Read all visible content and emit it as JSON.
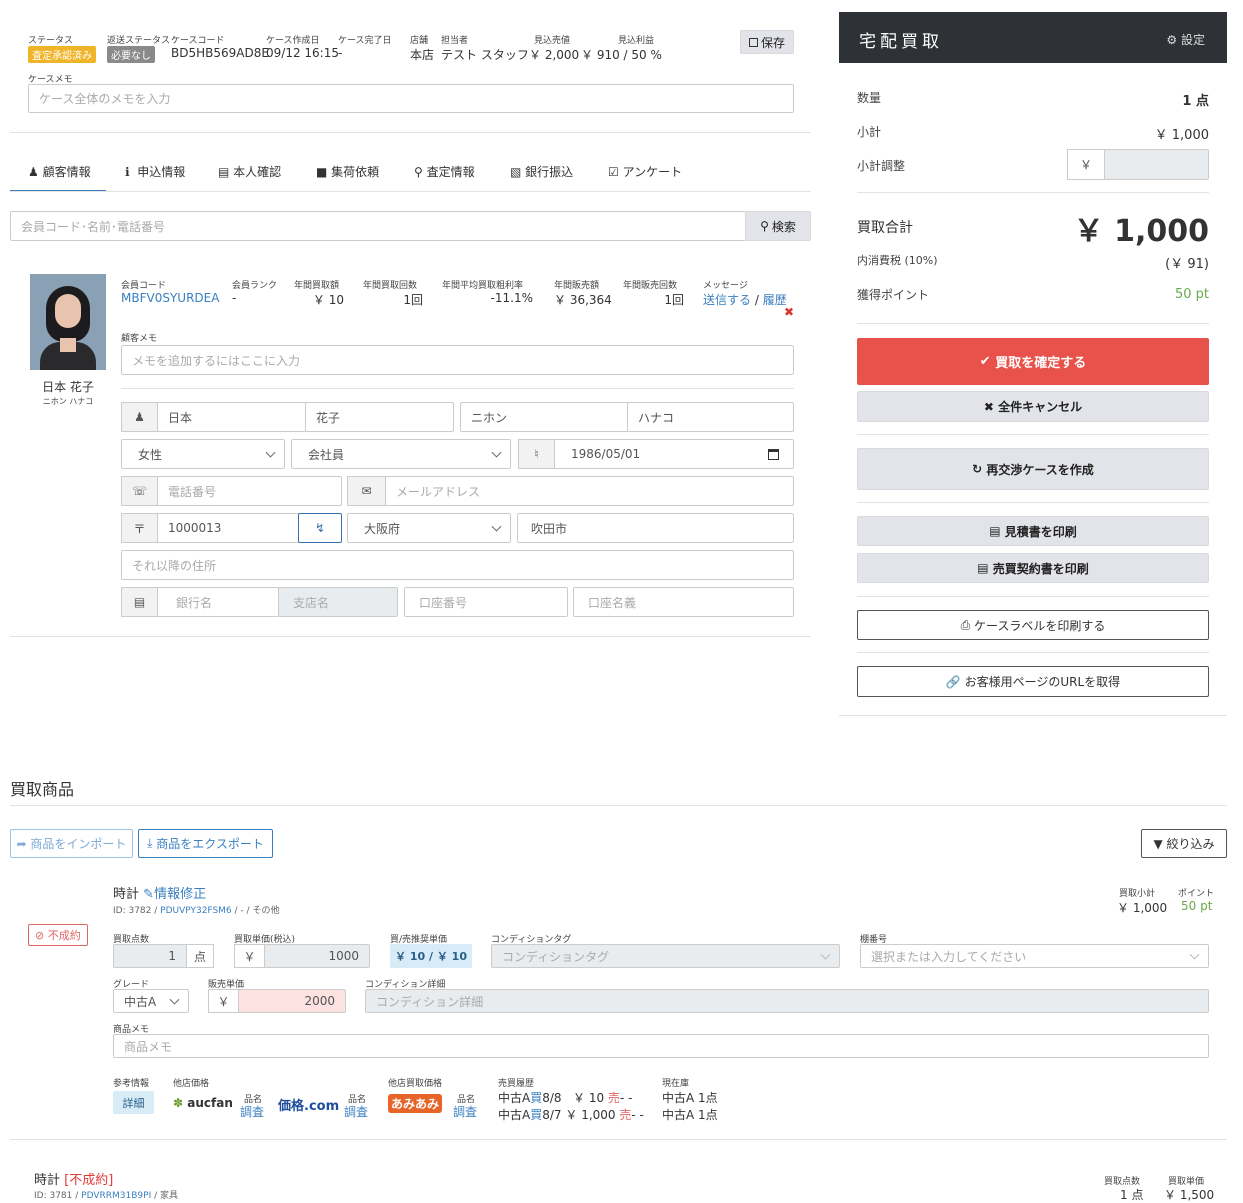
{
  "header": {
    "status_label": "ステータス",
    "status_badge": "査定承認済み",
    "return_status_label": "返送ステータス",
    "return_status_badge": "必要なし",
    "case_code_label": "ケースコード",
    "case_code": "BD5HB569AD8E",
    "created_label": "ケース作成日",
    "created": "09/12 16:15",
    "completed_label": "ケース完了日",
    "completed": "-",
    "store_label": "店舗",
    "store": "本店",
    "staff_label": "担当者",
    "staff": "テスト スタッフ",
    "est_sales_label": "見込売値",
    "est_sales": "￥ 2,000",
    "est_profit_label": "見込利益",
    "est_profit": "￥ 910 / 50 %",
    "save_label": "保存",
    "memo_label": "ケースメモ",
    "memo_placeholder": "ケース全体のメモを入力"
  },
  "tabs": [
    {
      "label": "顧客情報",
      "icon": "user-icon",
      "active": true
    },
    {
      "label": "申込情報",
      "icon": "info-icon"
    },
    {
      "label": "本人確認",
      "icon": "id-card-icon"
    },
    {
      "label": "集荷依頼",
      "icon": "truck-icon"
    },
    {
      "label": "査定情報",
      "icon": "search-icon"
    },
    {
      "label": "銀行振込",
      "icon": "money-icon"
    },
    {
      "label": "アンケート",
      "icon": "check-square-icon"
    }
  ],
  "search": {
    "placeholder": "会員コード･名前･電話番号",
    "button_label": "検索"
  },
  "customer": {
    "name": "日本 花子",
    "kana": "ニホン ハナコ",
    "member_code_label": "会員コード",
    "member_code": "MBFV0SYURDEA",
    "rank_label": "会員ランク",
    "rank": "-",
    "annual_buy_label": "年間買取額",
    "annual_buy": "￥ 10",
    "annual_buy_count_label": "年間買取回数",
    "annual_buy_count": "1回",
    "avg_margin_label": "年間平均買取粗利率",
    "avg_margin": "-11.1%",
    "annual_sales_label": "年間販売額",
    "annual_sales": "￥ 36,364",
    "annual_sales_count_label": "年間販売回数",
    "annual_sales_count": "1回",
    "message_label": "メッセージ",
    "message_send": "送信する",
    "message_sep": "/",
    "message_history": "履歴",
    "memo_label": "顧客メモ",
    "memo_placeholder": "メモを追加するにはここに入力",
    "last_name": "日本",
    "first_name": "花子",
    "last_kana": "ニホン",
    "first_kana": "ハナコ",
    "gender": "女性",
    "occupation": "会社員",
    "birthday": "1986/05/01",
    "phone_placeholder": "電話番号",
    "email_placeholder": "メールアドレス",
    "zip": "1000013",
    "prefecture": "大阪府",
    "city": "吹田市",
    "address_placeholder": "それ以降の住所",
    "bank_placeholder": "銀行名",
    "branch_placeholder": "支店名",
    "account_number_placeholder": "口座番号",
    "account_name_placeholder": "口座名義"
  },
  "panel": {
    "title": "宅配買取",
    "settings_label": "設定",
    "qty_label": "数量",
    "qty": "1 点",
    "subtotal_label": "小計",
    "subtotal": "￥ 1,000",
    "adjust_label": "小計調整",
    "adjust_prefix": "￥",
    "total_label": "買取合計",
    "total": "￥ 1,000",
    "tax_label": "内消費税 (10%)",
    "tax": "(￥ 91)",
    "points_label": "獲得ポイント",
    "points": "50 pt",
    "confirm_label": "買取を確定する",
    "cancel_all_label": "全件キャンセル",
    "renegotiate_label": "再交渉ケースを作成",
    "estimate_label": "見積書を印刷",
    "contract_label": "売買契約書を印刷",
    "case_label_label": "ケースラベルを印刷する",
    "customer_url_label": "お客様用ページのURLを取得"
  },
  "products": {
    "section_title": "買取商品",
    "import_label": "商品をインポート",
    "export_label": "商品をエクスポート",
    "filter_label": "絞り込み",
    "item1": {
      "name": "時計",
      "edit_label": "情報修正",
      "id_prefix": "ID: 3782 /",
      "code": "PDUVPY32FSM6",
      "path": "/ - / その他",
      "status": "不成約",
      "subtotal_label": "買取小計",
      "subtotal": "￥ 1,000",
      "points_label": "ポイント",
      "points": "50 pt",
      "qty_label": "買取点数",
      "qty": "1",
      "qty_unit": "点",
      "unit_price_label": "買取単価(税込)",
      "yen": "￥",
      "unit_price": "1000",
      "recommend_label": "買/売推奨単価",
      "recommend": "￥ 10 / ￥ 10",
      "condition_tag_label": "コンディションタグ",
      "condition_tag_placeholder": "コンディションタグ",
      "shelf_label": "棚番号",
      "shelf_placeholder": "選択または入力してください",
      "grade_label": "グレード",
      "grade": "中古A",
      "sale_price_label": "販売単価",
      "sale_price": "2000",
      "condition_detail_label": "コンディション詳細",
      "condition_detail_placeholder": "コンディション詳細",
      "memo_label": "商品メモ",
      "memo_placeholder": "商品メモ",
      "ref_label": "参考情報",
      "detail_label": "詳細",
      "other_price_label": "他店価格",
      "aucfan_logo": "aucfan",
      "kakaku_logo": "価格.com",
      "item_name_label": "品名",
      "survey_label": "調査",
      "other_buy_label": "他店買取価格",
      "amiami_logo": "あみあみ",
      "history_label": "売買履歴",
      "history": [
        {
          "grade": "中古A",
          "buy": "買",
          "date": "8/8",
          "price": "￥ 10",
          "sell": "売",
          "rest": "- -"
        },
        {
          "grade": "中古A",
          "buy": "買",
          "date": "8/7",
          "price": "￥ 1,000",
          "sell": "売",
          "rest": "- -"
        }
      ],
      "stock_label": "現在庫",
      "stock": [
        "中古A 1点",
        "中古A 1点"
      ]
    },
    "item2": {
      "name": "時計",
      "status": "[不成約]",
      "id_prefix": "ID: 3781 /",
      "code": "PDVRRM31B9PI",
      "path": "/ 家具",
      "qty_label": "買取点数",
      "qty": "1 点",
      "unit_price_label": "買取単価",
      "unit_price": "￥ 1,500"
    }
  },
  "colors": {
    "status_badge": "#f0b428",
    "return_badge": "#8a8a8a",
    "link": "#3a7fc1",
    "danger": "#e9524a",
    "panel_header": "#2e3136",
    "points_green": "#6aa84f"
  }
}
